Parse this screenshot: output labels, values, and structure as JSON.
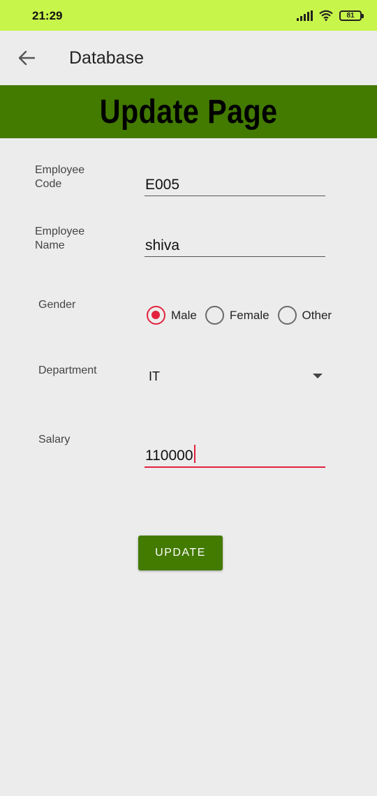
{
  "status": {
    "time": "21:29",
    "battery": "81",
    "icons": [
      "signal-icon",
      "wifi-icon",
      "battery-icon"
    ]
  },
  "app_bar": {
    "title": "Database",
    "back_icon": "arrow-left-icon"
  },
  "banner": {
    "title": "Update Page"
  },
  "form": {
    "employee_code": {
      "label": "Employee\nCode",
      "value": "E005"
    },
    "employee_name": {
      "label": "Employee\nName",
      "value": "shiva"
    },
    "gender": {
      "label": "Gender",
      "options": [
        "Male",
        "Female",
        "Other"
      ],
      "selected": "Male"
    },
    "department": {
      "label": "Department",
      "value": "IT"
    },
    "salary": {
      "label": "Salary",
      "value": "110000"
    },
    "update_label": "UPDATE"
  },
  "colors": {
    "status_bar": "#c8f54a",
    "banner": "#437a00",
    "button": "#437a00",
    "accent": "#e2223e",
    "background": "#ececec"
  }
}
